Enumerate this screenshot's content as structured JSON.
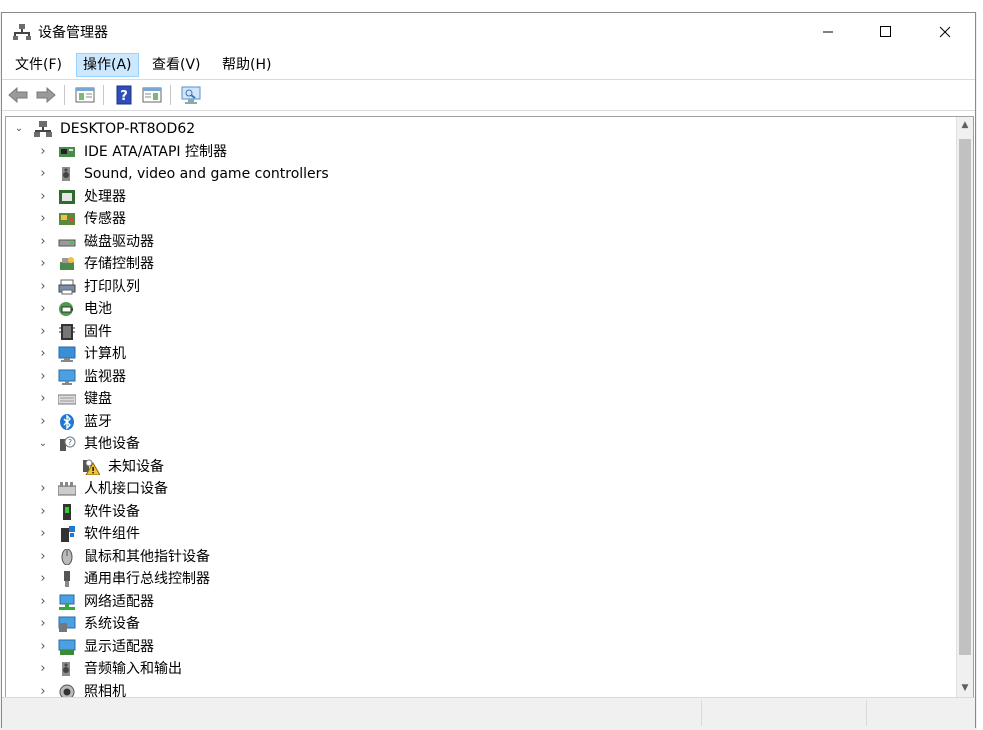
{
  "window": {
    "title": "设备管理器"
  },
  "menu": [
    "文件(F)",
    "操作(A)",
    "查看(V)",
    "帮助(H)"
  ],
  "tree": {
    "root": "DESKTOP-RT8OD62",
    "items": [
      {
        "label": "IDE ATA/ATAPI 控制器",
        "icon": "ide-controller-icon",
        "expanded": false
      },
      {
        "label": "Sound, video and game controllers",
        "icon": "speaker-icon",
        "expanded": false
      },
      {
        "label": "处理器",
        "icon": "cpu-icon",
        "expanded": false
      },
      {
        "label": "传感器",
        "icon": "sensor-icon",
        "expanded": false
      },
      {
        "label": "磁盘驱动器",
        "icon": "disk-drive-icon",
        "expanded": false
      },
      {
        "label": "存储控制器",
        "icon": "storage-controller-icon",
        "expanded": false
      },
      {
        "label": "打印队列",
        "icon": "printer-icon",
        "expanded": false
      },
      {
        "label": "电池",
        "icon": "battery-icon",
        "expanded": false
      },
      {
        "label": "固件",
        "icon": "firmware-icon",
        "expanded": false
      },
      {
        "label": "计算机",
        "icon": "computer-icon",
        "expanded": false
      },
      {
        "label": "监视器",
        "icon": "monitor-icon",
        "expanded": false
      },
      {
        "label": "键盘",
        "icon": "keyboard-icon",
        "expanded": false
      },
      {
        "label": "蓝牙",
        "icon": "bluetooth-icon",
        "expanded": false
      },
      {
        "label": "其他设备",
        "icon": "other-devices-icon",
        "expanded": true
      },
      {
        "label": "未知设备",
        "icon": "unknown-device-warning-icon",
        "child": true
      },
      {
        "label": "人机接口设备",
        "icon": "hid-icon",
        "expanded": false
      },
      {
        "label": "软件设备",
        "icon": "software-device-icon",
        "expanded": false
      },
      {
        "label": "软件组件",
        "icon": "software-component-icon",
        "expanded": false
      },
      {
        "label": "鼠标和其他指针设备",
        "icon": "mouse-icon",
        "expanded": false
      },
      {
        "label": "通用串行总线控制器",
        "icon": "usb-icon",
        "expanded": false
      },
      {
        "label": "网络适配器",
        "icon": "network-adapter-icon",
        "expanded": false
      },
      {
        "label": "系统设备",
        "icon": "system-device-icon",
        "expanded": false
      },
      {
        "label": "显示适配器",
        "icon": "display-adapter-icon",
        "expanded": false
      },
      {
        "label": "音频输入和输出",
        "icon": "audio-io-icon",
        "expanded": false
      },
      {
        "label": "照相机",
        "icon": "camera-icon",
        "expanded": false
      }
    ]
  },
  "colors": {
    "selection": "#cce8ff",
    "scroll_thumb": "#c1c1c1",
    "accent": "#1e78d4"
  }
}
